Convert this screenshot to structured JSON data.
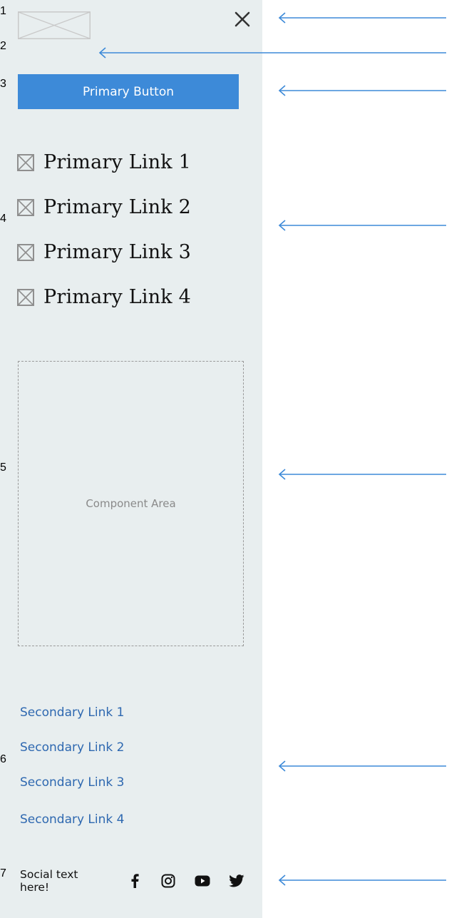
{
  "drawer": {
    "background": "#e8eeef",
    "logo_icon": "image-placeholder-icon",
    "close_icon": "close-icon",
    "primary_button": "Primary Button",
    "primary_links": [
      {
        "label": "Primary Link 1",
        "icon": "image-placeholder-icon"
      },
      {
        "label": "Primary Link 2",
        "icon": "image-placeholder-icon"
      },
      {
        "label": "Primary Link 3",
        "icon": "image-placeholder-icon"
      },
      {
        "label": "Primary Link 4",
        "icon": "image-placeholder-icon"
      }
    ],
    "component_area": "Component Area",
    "secondary_links": [
      "Secondary Link 1",
      "Secondary Link 2",
      "Secondary Link 3",
      "Secondary Link 4"
    ],
    "social": {
      "text": "Social text here!",
      "icons": [
        "facebook-icon",
        "instagram-icon",
        "youtube-icon",
        "twitter-icon"
      ]
    }
  },
  "callouts": [
    "1",
    "2",
    "3",
    "4",
    "5",
    "6",
    "7"
  ],
  "colors": {
    "accent": "#3d8ad8",
    "secondary_link": "#2e68b0",
    "panel": "#e8eeef"
  }
}
